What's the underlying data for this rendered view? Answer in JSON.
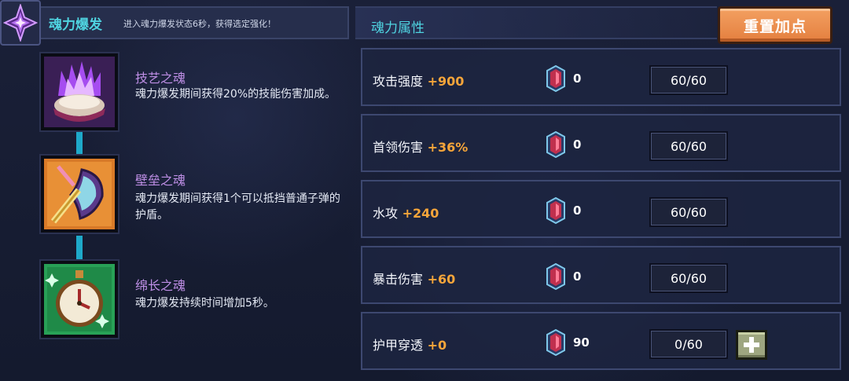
{
  "burst": {
    "title": "魂力爆发",
    "description": "进入魂力爆发状态6秒，获得选定强化！"
  },
  "skills": [
    {
      "name": "技艺之魂",
      "description": "魂力爆发期间获得20%的技能伤害加成。",
      "icon": "purple-flame-icon"
    },
    {
      "name": "壁垒之魂",
      "description": "魂力爆发期间获得1个可以抵挡普通子弹的护盾。",
      "icon": "shield-sword-icon"
    },
    {
      "name": "绵长之魂",
      "description": "魂力爆发持续时间增加5秒。",
      "icon": "stopwatch-icon"
    }
  ],
  "attributes": {
    "title": "魂力属性",
    "reset_label": "重置加点",
    "rows": [
      {
        "label": "攻击强度",
        "bonus": "+900",
        "gems": "0",
        "level": "60/60",
        "can_add": false
      },
      {
        "label": "首领伤害",
        "bonus": "+36%",
        "gems": "0",
        "level": "60/60",
        "can_add": false
      },
      {
        "label": "水攻",
        "bonus": "+240",
        "gems": "0",
        "level": "60/60",
        "can_add": false
      },
      {
        "label": "暴击伤害",
        "bonus": "+60",
        "gems": "0",
        "level": "60/60",
        "can_add": false
      },
      {
        "label": "护甲穿透",
        "bonus": "+0",
        "gems": "90",
        "level": "0/60",
        "can_add": true
      }
    ]
  },
  "colors": {
    "accent_cyan": "#4fd3e0",
    "bonus_orange": "#f5a53a",
    "skill_name_purple": "#bf8fe6",
    "reset_orange": "#e47f3f",
    "connector": "#1ea9c9"
  }
}
